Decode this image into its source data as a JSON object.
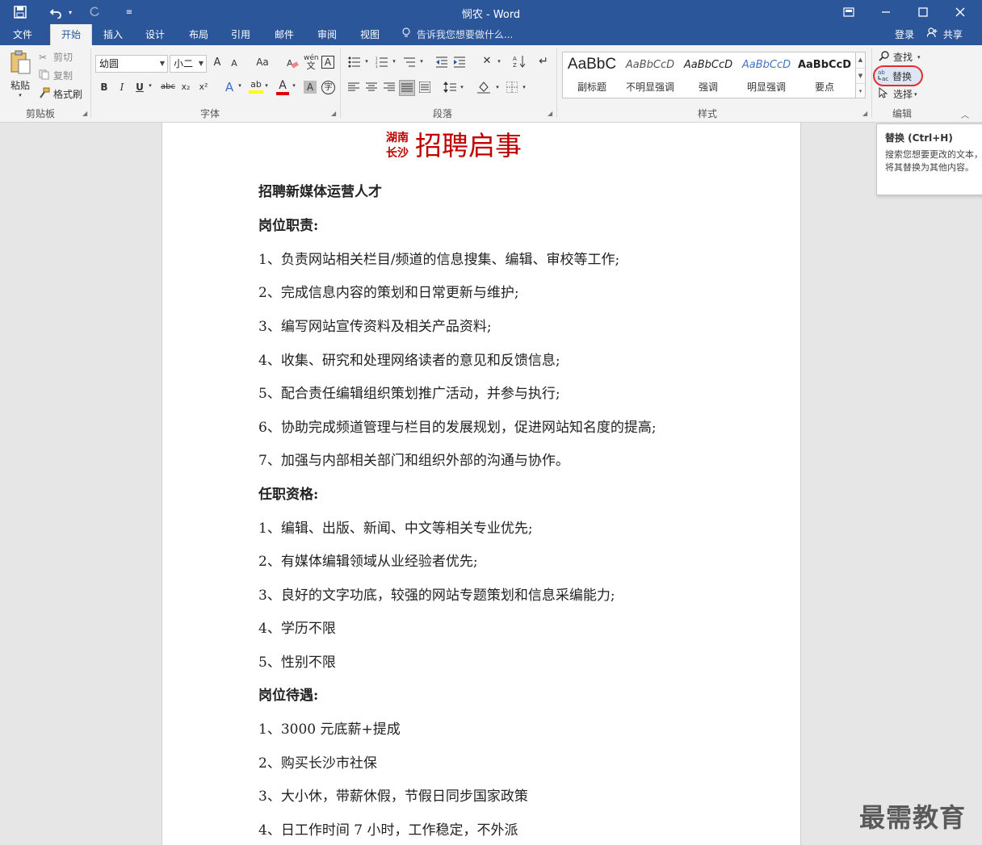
{
  "window": {
    "title": "悯农 - Word"
  },
  "quick_access": {
    "save_icon": "save-icon",
    "undo_icon": "undo-icon",
    "redo_icon": "redo-icon",
    "customize_icon": "customize-icon"
  },
  "tabs": [
    {
      "label": "文件"
    },
    {
      "label": "开始"
    },
    {
      "label": "插入"
    },
    {
      "label": "设计"
    },
    {
      "label": "布局"
    },
    {
      "label": "引用"
    },
    {
      "label": "邮件"
    },
    {
      "label": "审阅"
    },
    {
      "label": "视图"
    }
  ],
  "active_tab": "开始",
  "tell_me": "告诉我您想要做什么...",
  "account": {
    "signin": "登录",
    "share": "共享"
  },
  "clipboard": {
    "paste": "粘贴",
    "cut": "剪切",
    "copy": "复制",
    "format_painter": "格式刷",
    "group_label": "剪贴板"
  },
  "font": {
    "name": "幼圆",
    "size": "小二",
    "group_label": "字体",
    "bold": "B",
    "italic": "I",
    "underline": "U",
    "strike": "abc",
    "subscript": "x₂",
    "superscript": "x²",
    "grow": "A",
    "shrink": "A",
    "change_case": "Aa",
    "phonetic": "wén",
    "char_border": "A",
    "effects": "A",
    "highlight": "ab",
    "font_color": "A",
    "char_shading": "A",
    "enclose": "字"
  },
  "paragraph": {
    "group_label": "段落"
  },
  "styles": {
    "group_label": "样式",
    "items": [
      {
        "sample": "AaBbC",
        "name": "副标题"
      },
      {
        "sample": "AaBbCcD",
        "name": "不明显强调"
      },
      {
        "sample": "AaBbCcD",
        "name": "强调"
      },
      {
        "sample": "AaBbCcD",
        "name": "明显强调"
      },
      {
        "sample": "AaBbCcD",
        "name": "要点"
      }
    ]
  },
  "editing": {
    "group_label": "编辑",
    "find": "查找",
    "replace": "替换",
    "select": "选择"
  },
  "tooltip": {
    "title": "替换 (Ctrl+H)",
    "body": "搜索您想要更改的文本，将其替换为其他内容。"
  },
  "document": {
    "title_small_line1": "湖南",
    "title_small_line2": "长沙",
    "title_big": "招聘启事",
    "paragraphs": [
      {
        "text": "招聘新媒体运营人才",
        "bold": true
      },
      {
        "text": "岗位职责:",
        "bold": true
      },
      {
        "text": "1、负责网站相关栏目/频道的信息搜集、编辑、审校等工作;",
        "bold": false
      },
      {
        "text": "2、完成信息内容的策划和日常更新与维护;",
        "bold": false
      },
      {
        "text": "3、编写网站宣传资料及相关产品资料;",
        "bold": false
      },
      {
        "text": "4、收集、研究和处理网络读者的意见和反馈信息;",
        "bold": false
      },
      {
        "text": "5、配合责任编辑组织策划推广活动，并参与执行;",
        "bold": false
      },
      {
        "text": "6、协助完成频道管理与栏目的发展规划，促进网站知名度的提高;",
        "bold": false
      },
      {
        "text": "7、加强与内部相关部门和组织外部的沟通与协作。",
        "bold": false
      },
      {
        "text": "任职资格:",
        "bold": true
      },
      {
        "text": "1、编辑、出版、新闻、中文等相关专业优先;",
        "bold": false
      },
      {
        "text": "2、有媒体编辑领域从业经验者优先;",
        "bold": false
      },
      {
        "text": "3、良好的文字功底，较强的网站专题策划和信息采编能力;",
        "bold": false
      },
      {
        "text": "4、学历不限",
        "bold": false
      },
      {
        "text": "5、性别不限",
        "bold": false
      },
      {
        "text": "岗位待遇:",
        "bold": true
      },
      {
        "text": "1、3000 元底薪+提成",
        "bold": false
      },
      {
        "text": "2、购买长沙市社保",
        "bold": false
      },
      {
        "text": "3、大小休，带薪休假，节假日同步国家政策",
        "bold": false
      },
      {
        "text": "4、日工作时间 7 小时，工作稳定，不外派",
        "bold": false
      }
    ]
  },
  "watermark": "最需教育",
  "colors": {
    "titlebar": "#2b579a",
    "ribbon": "#f3f3f3",
    "heading_red": "#c00000",
    "highlight_oval": "#e03030"
  }
}
